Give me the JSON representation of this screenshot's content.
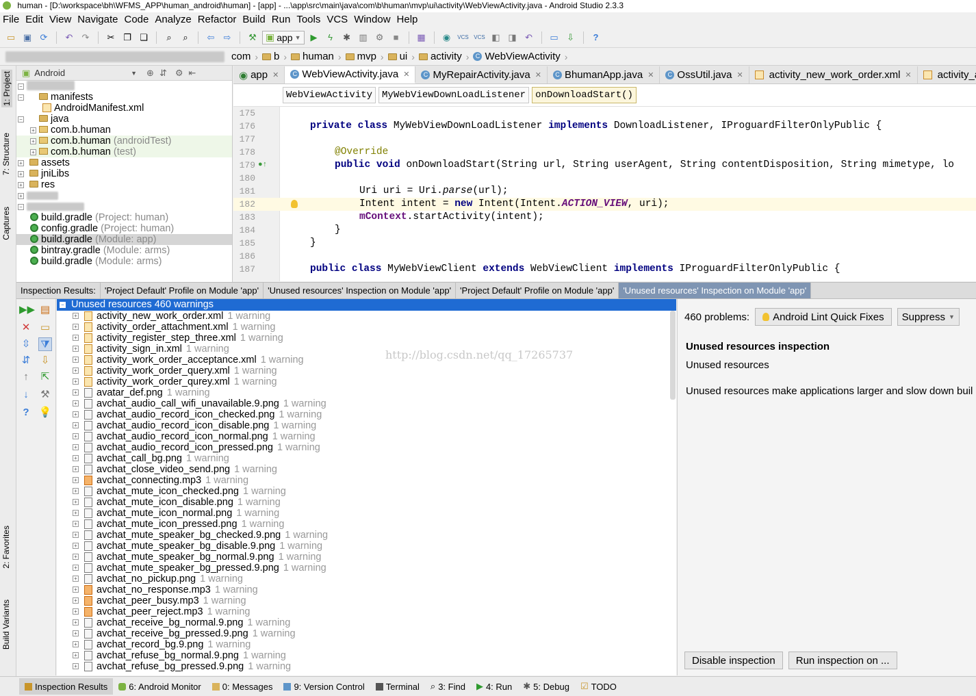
{
  "window": {
    "title": "human - [D:\\workspace\\bh\\WFMS_APP\\human_android\\human] - [app] - ...\\app\\src\\main\\java\\com\\b\\human\\mvp\\ui\\activity\\WebViewActivity.java - Android Studio 2.3.3"
  },
  "menu": [
    "File",
    "Edit",
    "View",
    "Navigate",
    "Code",
    "Analyze",
    "Refactor",
    "Build",
    "Run",
    "Tools",
    "VCS",
    "Window",
    "Help"
  ],
  "toolbar": {
    "run_config": "app"
  },
  "navbar": {
    "crumbs": [
      "com",
      "b",
      "human",
      "mvp",
      "ui",
      "activity",
      "WebViewActivity"
    ]
  },
  "left_tool_tabs": {
    "project": "1: Project",
    "structure": "7: Structure",
    "captures": "Captures",
    "favorites": "2: Favorites",
    "build_variants": "Build Variants"
  },
  "project": {
    "view_mode": "Android",
    "tree": [
      {
        "label": "manifests",
        "suffix": ""
      },
      {
        "label": "AndroidManifest.xml",
        "suffix": ""
      },
      {
        "label": "java",
        "suffix": ""
      },
      {
        "label": "com.b.human",
        "suffix": ""
      },
      {
        "label": "com.b.human",
        "suffix": "(androidTest)"
      },
      {
        "label": "com.b.human",
        "suffix": "(test)"
      },
      {
        "label": "assets",
        "suffix": ""
      },
      {
        "label": "jniLibs",
        "suffix": ""
      },
      {
        "label": "res",
        "suffix": ""
      },
      {
        "label": "build.gradle",
        "suffix": "(Project: human)"
      },
      {
        "label": "config.gradle",
        "suffix": "(Project: human)"
      },
      {
        "label": "build.gradle",
        "suffix": "(Module: app)"
      },
      {
        "label": "bintray.gradle",
        "suffix": "(Module: arms)"
      },
      {
        "label": "build.gradle",
        "suffix": "(Module: arms)"
      }
    ]
  },
  "editor_tabs": [
    "app",
    "WebViewActivity.java",
    "MyRepairActivity.java",
    "BhumanApp.java",
    "OssUtil.java",
    "activity_new_work_order.xml",
    "activity_ac"
  ],
  "code_breadcrumbs": [
    "WebViewActivity",
    "MyWebViewDownLoadListener",
    "onDownloadStart()"
  ],
  "code": {
    "line_numbers": [
      "175",
      "176",
      "177",
      "178",
      "179",
      "180",
      "181",
      "182",
      "183",
      "184",
      "185",
      "186",
      "187"
    ],
    "line_176": {
      "kw1": "private",
      "kw2": "class",
      "name": "MyWebViewDownLoadListener",
      "kw3": "implements",
      "rest": "DownloadListener, IProguardFilterOnlyPublic {"
    },
    "line_178": "@Override",
    "line_179": {
      "kw1": "public",
      "kw2": "void",
      "rest": "onDownloadStart(String url, String userAgent, String contentDisposition, String mimetype, lo"
    },
    "line_181": {
      "a": "Uri uri = Uri.",
      "b": "parse",
      "c": "(url);"
    },
    "line_182": {
      "a": "Intent intent = ",
      "kw": "new",
      "b": " Intent(Intent.",
      "c": "ACTION_VIEW",
      "d": ", uri);"
    },
    "line_183": {
      "a": "mContext",
      "b": ".startActivity(intent);"
    },
    "line_184": "}",
    "line_185": "}",
    "line_187": {
      "kw1": "public",
      "kw2": "class",
      "name": "MyWebViewClient",
      "kw3": "extends",
      "mid": "WebViewClient",
      "kw4": "implements",
      "rest": "IProguardFilterOnlyPublic {"
    }
  },
  "inspection": {
    "label": "Inspection Results:",
    "tabs": [
      "'Project Default' Profile on Module 'app'",
      "'Unused resources' Inspection on Module 'app'",
      "'Project Default' Profile on Module 'app'",
      "'Unused resources' Inspection on Module 'app'"
    ],
    "root": "Unused resources  460 warnings",
    "items": [
      {
        "name": "activity_new_work_order.xml",
        "count": "1 warning",
        "type": "xml"
      },
      {
        "name": "activity_order_attachment.xml",
        "count": "1 warning",
        "type": "xml"
      },
      {
        "name": "activity_register_step_three.xml",
        "count": "1 warning",
        "type": "xml"
      },
      {
        "name": "activity_sign_in.xml",
        "count": "1 warning",
        "type": "xml"
      },
      {
        "name": "activity_work_order_acceptance.xml",
        "count": "1 warning",
        "type": "xml"
      },
      {
        "name": "activity_work_order_query.xml",
        "count": "1 warning",
        "type": "xml"
      },
      {
        "name": "activity_work_order_qurey.xml",
        "count": "1 warning",
        "type": "xml"
      },
      {
        "name": "avatar_def.png",
        "count": "1 warning",
        "type": "png"
      },
      {
        "name": "avchat_audio_call_wifi_unavailable.9.png",
        "count": "1 warning",
        "type": "png"
      },
      {
        "name": "avchat_audio_record_icon_checked.png",
        "count": "1 warning",
        "type": "png"
      },
      {
        "name": "avchat_audio_record_icon_disable.png",
        "count": "1 warning",
        "type": "png"
      },
      {
        "name": "avchat_audio_record_icon_normal.png",
        "count": "1 warning",
        "type": "png"
      },
      {
        "name": "avchat_audio_record_icon_pressed.png",
        "count": "1 warning",
        "type": "png"
      },
      {
        "name": "avchat_call_bg.png",
        "count": "1 warning",
        "type": "png"
      },
      {
        "name": "avchat_close_video_send.png",
        "count": "1 warning",
        "type": "png"
      },
      {
        "name": "avchat_connecting.mp3",
        "count": "1 warning",
        "type": "mp3"
      },
      {
        "name": "avchat_mute_icon_checked.png",
        "count": "1 warning",
        "type": "png"
      },
      {
        "name": "avchat_mute_icon_disable.png",
        "count": "1 warning",
        "type": "png"
      },
      {
        "name": "avchat_mute_icon_normal.png",
        "count": "1 warning",
        "type": "png"
      },
      {
        "name": "avchat_mute_icon_pressed.png",
        "count": "1 warning",
        "type": "png"
      },
      {
        "name": "avchat_mute_speaker_bg_checked.9.png",
        "count": "1 warning",
        "type": "png"
      },
      {
        "name": "avchat_mute_speaker_bg_disable.9.png",
        "count": "1 warning",
        "type": "png"
      },
      {
        "name": "avchat_mute_speaker_bg_normal.9.png",
        "count": "1 warning",
        "type": "png"
      },
      {
        "name": "avchat_mute_speaker_bg_pressed.9.png",
        "count": "1 warning",
        "type": "png"
      },
      {
        "name": "avchat_no_pickup.png",
        "count": "1 warning",
        "type": "png"
      },
      {
        "name": "avchat_no_response.mp3",
        "count": "1 warning",
        "type": "mp3"
      },
      {
        "name": "avchat_peer_busy.mp3",
        "count": "1 warning",
        "type": "mp3"
      },
      {
        "name": "avchat_peer_reject.mp3",
        "count": "1 warning",
        "type": "mp3"
      },
      {
        "name": "avchat_receive_bg_normal.9.png",
        "count": "1 warning",
        "type": "png"
      },
      {
        "name": "avchat_receive_bg_pressed.9.png",
        "count": "1 warning",
        "type": "png"
      },
      {
        "name": "avchat_record_bg.9.png",
        "count": "1 warning",
        "type": "png"
      },
      {
        "name": "avchat_refuse_bg_normal.9.png",
        "count": "1 warning",
        "type": "png"
      },
      {
        "name": "avchat_refuse_bg_pressed.9.png",
        "count": "1 warning",
        "type": "png"
      }
    ],
    "watermark": "http://blog.csdn.net/qq_17265737"
  },
  "details": {
    "problems": "460 problems:",
    "quick_fixes": "Android Lint Quick Fixes",
    "suppress": "Suppress",
    "title": "Unused resources inspection",
    "subtitle": "Unused resources",
    "description": "Unused resources make applications larger and slow down buil",
    "disable_btn": "Disable inspection",
    "run_btn": "Run inspection on ..."
  },
  "statusbar": [
    {
      "label": "Inspection Results",
      "active": true
    },
    {
      "label": "6: Android Monitor"
    },
    {
      "label": "0: Messages"
    },
    {
      "label": "9: Version Control"
    },
    {
      "label": "Terminal"
    },
    {
      "label": "3: Find"
    },
    {
      "label": "4: Run"
    },
    {
      "label": "5: Debug"
    },
    {
      "label": "TODO"
    }
  ]
}
